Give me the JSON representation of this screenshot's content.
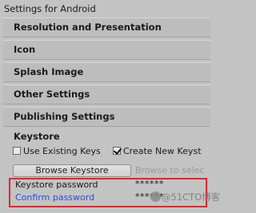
{
  "window": {
    "title": "Settings for Android"
  },
  "sections": [
    {
      "label": "Resolution and Presentation"
    },
    {
      "label": "Icon"
    },
    {
      "label": "Splash Image"
    },
    {
      "label": "Other Settings"
    },
    {
      "label": "Publishing Settings"
    }
  ],
  "keystore": {
    "heading": "Keystore",
    "use_existing_label": "Use Existing Keys",
    "use_existing_checked": false,
    "create_new_label": "Create New Keyst",
    "create_new_checked": true,
    "browse_button": "Browse Keystore",
    "browse_hint": "Browse to selec",
    "password_label": "Keystore password",
    "password_value": "******",
    "confirm_label": "Confirm password",
    "confirm_value": "******"
  },
  "highlight_color": "#e4262b",
  "label_color_default": "#1a1a1a",
  "label_color_confirm": "#2b4fd8",
  "watermark": {
    "text": "@51CTO博客",
    "icon": "blog-logo-icon"
  }
}
